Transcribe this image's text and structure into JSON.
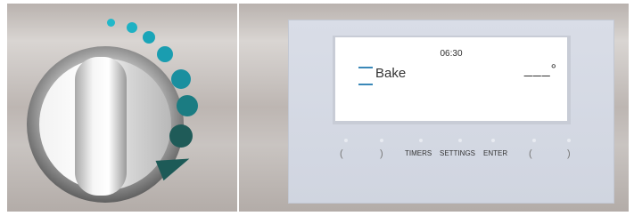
{
  "display": {
    "time": "06:30",
    "mode": "Bake",
    "temperature": "___°"
  },
  "buttons": {
    "left_paren_1": "(",
    "right_paren_1": ")",
    "timers": "TIMERS",
    "settings": "SETTINGS",
    "enter": "ENTER",
    "left_paren_2": "(",
    "right_paren_2": ")"
  },
  "icons": {
    "knob_arrow": "triangle-right-icon",
    "dial_scale": "circle-dot-icon"
  },
  "colors": {
    "dial_dots_start": "#20b6c8",
    "dial_dots_end": "#1f5b58",
    "accent_blue": "#3a88b8"
  }
}
